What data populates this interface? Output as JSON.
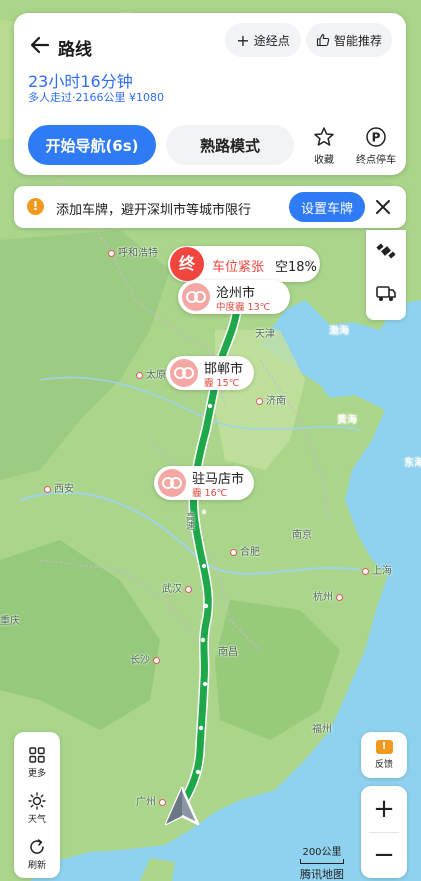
{
  "header": {
    "title": "路线",
    "waypoint_label": "途经点",
    "smart_label": "智能推荐"
  },
  "route": {
    "duration": "23小时16分钟",
    "summary": "多人走过·2166公里 ¥1080",
    "start_nav_label": "开始导航(6s)",
    "familiar_mode_label": "熟路模式",
    "favorite_label": "收藏",
    "dest_parking_label": "终点停车"
  },
  "plate_notice": {
    "text": "添加车牌，避开深圳市等城市限行",
    "button_label": "设置车牌",
    "icon": "warning-icon"
  },
  "destination": {
    "badge": "终",
    "status": "车位紧张",
    "space": "空18%"
  },
  "city_weather": [
    {
      "name": "沧州市",
      "weather": "中度霾 13℃"
    },
    {
      "name": "邯郸市",
      "weather": "霾 15℃"
    },
    {
      "name": "驻马店市",
      "weather": "霾 16℃"
    }
  ],
  "map_labels": {
    "hohhot": "呼和浩特",
    "tianjin": "天津",
    "taiyuan": "太原",
    "jinan": "济南",
    "xian": "西安",
    "hefei": "合肥",
    "nanjing": "南京",
    "shanghai": "上海",
    "wuhan": "武汉",
    "hangzhou": "杭州",
    "changsha": "长沙",
    "nanchang": "南昌",
    "fuzhou": "福州",
    "guangzhou": "广州",
    "chongqing": "重庆",
    "bohai": "渤海",
    "huanghai": "黄海",
    "donghai": "东海",
    "highway": "高速"
  },
  "left_tools": {
    "more_label": "更多",
    "weather_label": "天气",
    "refresh_label": "刷新"
  },
  "right_tools": {
    "feedback_label": "反馈",
    "zoom_in": "+",
    "zoom_out": "−"
  },
  "scale": {
    "distance": "200公里",
    "brand": "腾讯地图"
  },
  "colors": {
    "accent_blue": "#2f7af5",
    "route_green": "#1fa84a",
    "destination_red": "#f1453d",
    "haze_red": "#e14b41",
    "warning_orange": "#f29a1f"
  }
}
